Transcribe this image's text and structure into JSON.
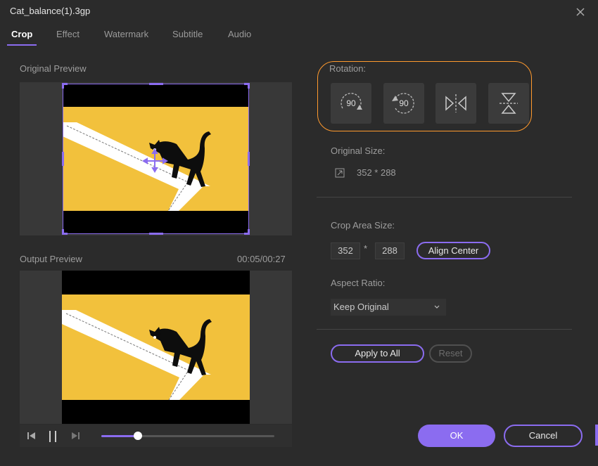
{
  "window": {
    "title": "Cat_balance(1).3gp"
  },
  "tabs": [
    {
      "label": "Crop"
    },
    {
      "label": "Effect"
    },
    {
      "label": "Watermark"
    },
    {
      "label": "Subtitle"
    },
    {
      "label": "Audio"
    }
  ],
  "active_tab": "Crop",
  "original_preview": {
    "label": "Original Preview"
  },
  "output_preview": {
    "label": "Output Preview",
    "time": "00:05/00:27"
  },
  "player": {
    "progress": 0.21
  },
  "rotation": {
    "label": "Rotation:",
    "rotate_cw_text": "90",
    "rotate_ccw_text": "90"
  },
  "original_size": {
    "label": "Original Size:",
    "value": "352 * 288"
  },
  "crop_area": {
    "label": "Crop Area Size:",
    "width": "352",
    "separator": "*",
    "height": "288",
    "align_center_label": "Align Center"
  },
  "aspect_ratio": {
    "label": "Aspect Ratio:",
    "selected": "Keep Original"
  },
  "apply_to_all_label": "Apply to All",
  "reset_label": "Reset",
  "ok_label": "OK",
  "cancel_label": "Cancel",
  "colors": {
    "accent": "#8b6cf0",
    "highlight": "#ff9a2e",
    "video_bg": "#f2c13c"
  }
}
